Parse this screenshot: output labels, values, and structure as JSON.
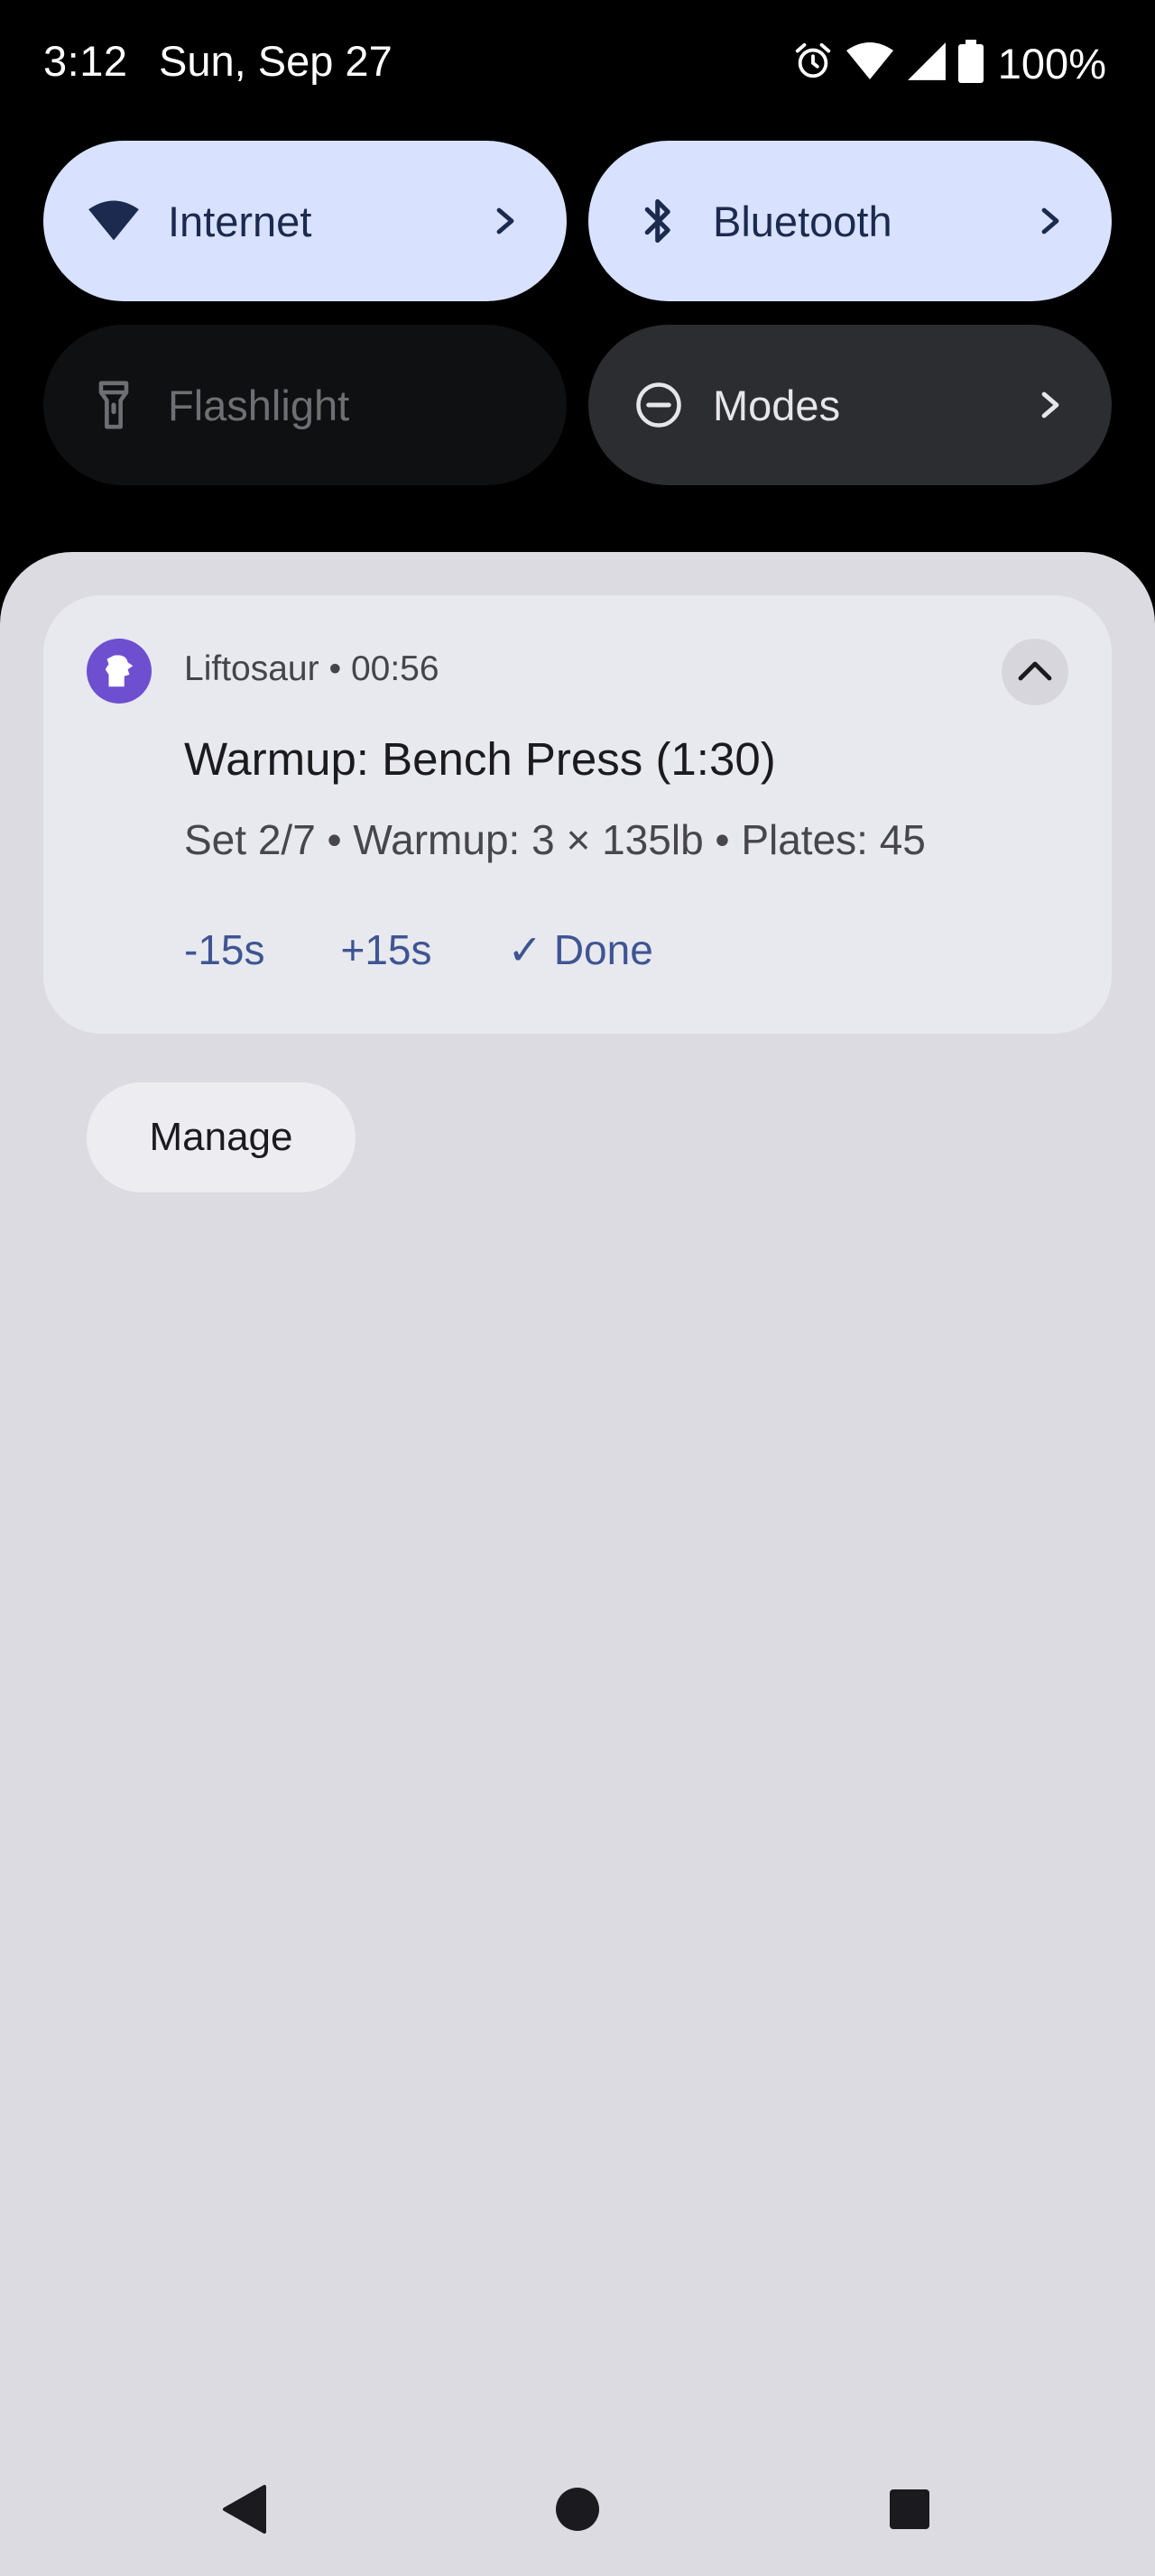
{
  "status_bar": {
    "time": "3:12",
    "date": "Sun, Sep 27",
    "battery": "100%",
    "icons": [
      "alarm-icon",
      "wifi-icon",
      "cellular-signal-icon",
      "battery-icon"
    ]
  },
  "quick_settings": {
    "internet": {
      "label": "Internet",
      "icon": "wifi-icon"
    },
    "bluetooth": {
      "label": "Bluetooth",
      "icon": "bluetooth-icon"
    },
    "flashlight": {
      "label": "Flashlight",
      "icon": "flashlight-icon"
    },
    "modes": {
      "label": "Modes",
      "icon": "do-not-disturb-icon"
    }
  },
  "notification": {
    "app_name": "Liftosaur",
    "separator": "•",
    "elapsed": "00:56",
    "title": "Warmup: Bench Press (1:30)",
    "body": "Set 2/7 • Warmup: 3 × 135lb • Plates: 45",
    "actions": {
      "minus": "-15s",
      "plus": "+15s",
      "done": "✓ Done"
    }
  },
  "manage_label": "Manage",
  "colors": {
    "tile_active": "#d8e2ff",
    "tile_inactive": "#0f1012",
    "tile_modes": "#2c2d31",
    "shade_bg": "#dbdbe1",
    "card_bg": "#e8e8ef",
    "accent": "#3e5592",
    "app_icon": "#6d4fd0"
  }
}
